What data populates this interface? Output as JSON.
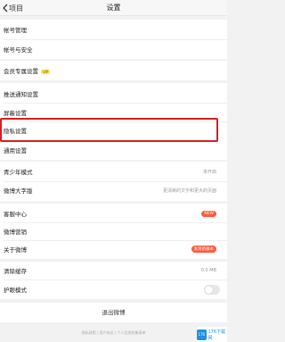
{
  "header": {
    "back_label": "项目",
    "title": "设置"
  },
  "rows": {
    "account_manage": "帐号管理",
    "account_security": "帐号与安全",
    "vip_settings": "会员专属设置",
    "vip_badge": "VIP",
    "push_settings": "推送通知设置",
    "display_settings": "屏蔽设置",
    "privacy_settings": "隐私设置",
    "general_settings": "通用设置",
    "youth_mode": "青少年模式",
    "youth_mode_value": "未开启",
    "large_font": "微博大字版",
    "large_font_value": "更清晰的文字和更大的页面",
    "help_center": "客服中心",
    "help_badge": "NEW",
    "weibo_marketing": "微博营销",
    "about_weibo": "关于微博",
    "about_badge": "发现新版本",
    "clear_cache": "清除缓存",
    "cache_size": "0.0 MB",
    "eye_mode": "护眼模式"
  },
  "logout_label": "退出微博",
  "footer_text": "隐私政策 | 用户协议 | 个人信息收集清单",
  "watermark": {
    "logo": "176",
    "text": "176下载网"
  },
  "colors": {
    "highlight": "#d81e1e",
    "background": "#f2f2f2",
    "badge": "#ff5a3c"
  }
}
